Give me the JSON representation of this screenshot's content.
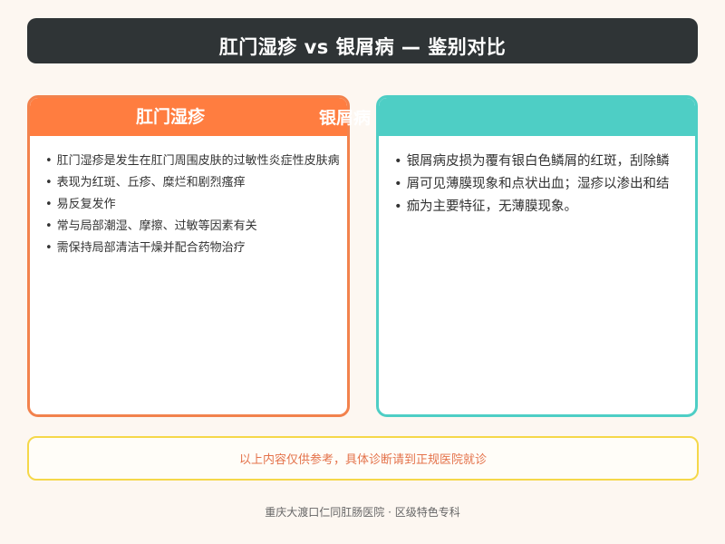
{
  "title": "肛门湿疹 vs 银屑病 — 鉴别对比",
  "left_card": {
    "heading": "肛门湿疹",
    "items": [
      "肛门湿疹是发生在肛门周围皮肤的过敏性炎症性皮肤病",
      "表现为红斑、丘疹、糜烂和剧烈瘙痒",
      "易反复发作",
      "常与局部潮湿、摩擦、过敏等因素有关",
      "需保持局部清洁干燥并配合药物治疗"
    ]
  },
  "right_card": {
    "heading": "银屑病",
    "items": [
      "银屑病皮损为覆有银白色鳞屑的红斑，刮除鳞",
      "屑可见薄膜现象和点状出血；湿疹以渗出和结",
      "痂为主要特征，无薄膜现象。"
    ]
  },
  "notice": "以上内容仅供参考，具体诊断请到正规医院就诊",
  "footer": "重庆大渡口仁同肛肠医院 · 区级特色专科",
  "colors": {
    "title_bg": "#2f3436",
    "left_accent": "#ff7d40",
    "right_accent": "#4ecec5",
    "notice_border": "#f5d84a",
    "notice_text": "#e4724a"
  }
}
